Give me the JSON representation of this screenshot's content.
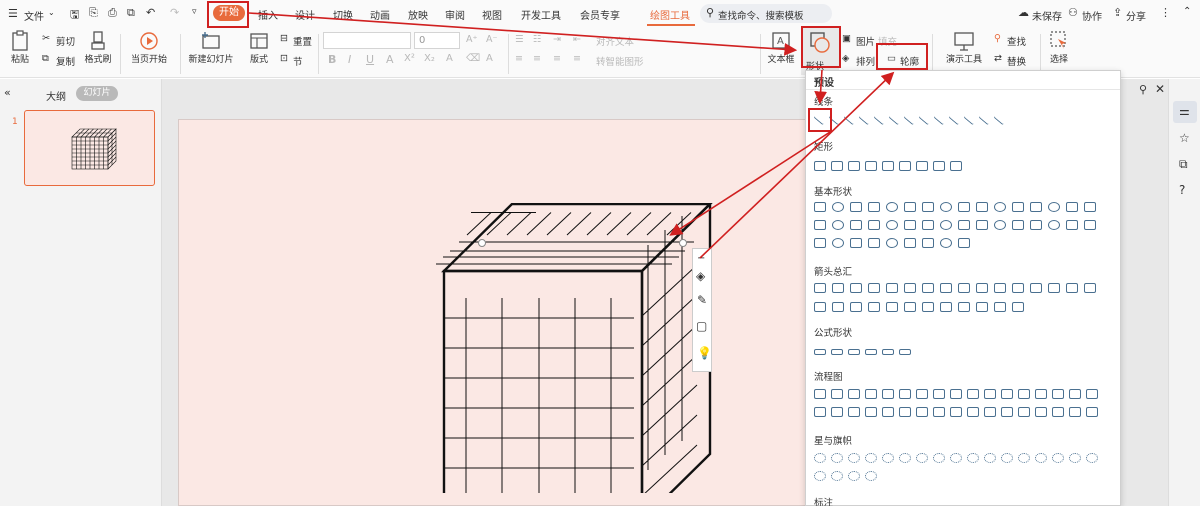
{
  "menu": {
    "file": "文件"
  },
  "tabs": [
    "开始",
    "插入",
    "设计",
    "切换",
    "动画",
    "放映",
    "审阅",
    "视图",
    "开发工具",
    "会员专享",
    "绘图工具"
  ],
  "search_placeholder": "查找命令、搜索模板",
  "status": {
    "unsaved": "未保存",
    "collab": "协作",
    "share": "分享"
  },
  "ribbon": {
    "paste": "粘贴",
    "cut": "剪切",
    "copy": "复制",
    "format_painter": "格式刷",
    "play_from_start": "当页开始",
    "new_slide": "新建幻灯片",
    "layout": "版式",
    "reset": "重置",
    "section": "节",
    "font_size": "0",
    "text_box": "文本框",
    "shape": "形状",
    "picture": "图片",
    "arrange": "排列",
    "outline": "轮廓",
    "fill": "填充",
    "align_text": "对齐文本",
    "smart_shape": "转智能图形",
    "present_tools": "演示工具",
    "find": "查找",
    "replace": "替换",
    "select": "选择"
  },
  "left_panel": {
    "outline_tab": "大纲",
    "slides_tab": "幻灯片",
    "slide_number": "1"
  },
  "shapes_panel": {
    "title": "预设",
    "sections": [
      "线条",
      "矩形",
      "基本形状",
      "箭头总汇",
      "公式形状",
      "流程图",
      "星与旗帜",
      "标注"
    ]
  },
  "colors": {
    "accent": "#e86a3c",
    "annotation": "#d02020",
    "slide_bg": "#fbe8e4",
    "shape_blue": "#4a7090"
  }
}
